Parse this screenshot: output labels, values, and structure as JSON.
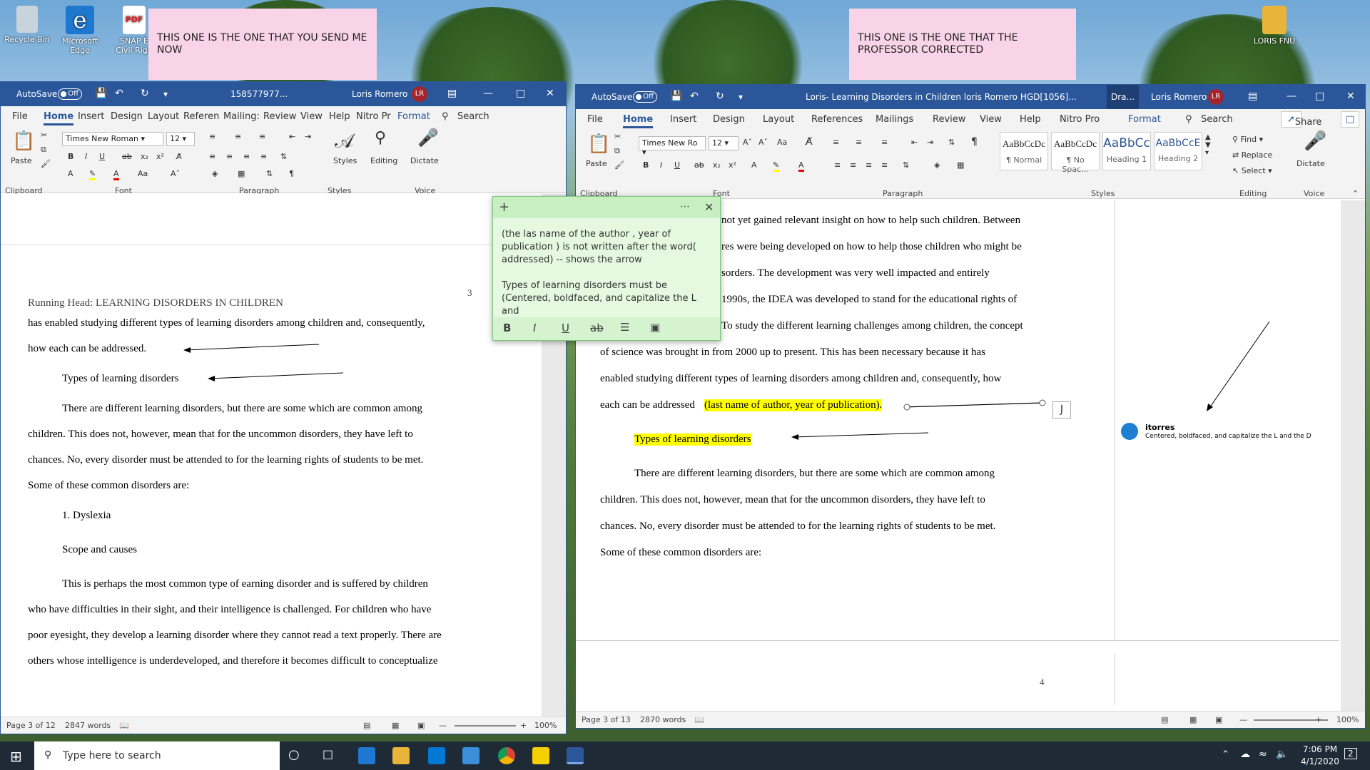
{
  "desktop": {
    "icons": [
      {
        "label": "Recycle Bin"
      },
      {
        "label": "Microsoft Edge"
      },
      {
        "label": "SNAP E Civil Righ"
      },
      {
        "label": "LORIS FNU"
      }
    ],
    "sticky_left": "THIS ONE IS THE ONE THAT YOU SEND ME NOW",
    "sticky_right": "THIS ONE IS THE ONE THAT THE PROFESSOR CORRECTED"
  },
  "left_window": {
    "autosave": "AutoSave",
    "toggle": "Off",
    "title": "158577977...",
    "user": "Loris Romero",
    "initials": "LR",
    "menu": [
      "File",
      "Home",
      "Insert",
      "Design",
      "Layout",
      "Referen",
      "Mailing:",
      "Review",
      "View",
      "Help",
      "Nitro Pr",
      "Format",
      "Search"
    ],
    "font_name": "Times New Roman",
    "font_size": "12",
    "groups": {
      "clipboard": "Clipboard",
      "font": "Font",
      "paragraph": "Paragraph",
      "styles": "Styles",
      "voice": "Voice"
    },
    "buttons": {
      "paste": "Paste",
      "styles": "Styles",
      "editing": "Editing",
      "dictate": "Dictate"
    },
    "running_head": "Running Head: LEARNING DISORDERS IN CHILDREN",
    "page_num": "3",
    "lines": [
      "has enabled studying different types of learning disorders among children and, consequently,",
      "how each can be addressed.",
      "Types of learning disorders",
      "There are different learning disorders, but there are some which are common among",
      "children. This does not, however, mean that for the uncommon disorders, they have left to",
      "chances. No, every disorder must be attended to for the learning rights of students to be met.",
      "Some of these common disorders are:",
      "1.   Dyslexia",
      "Scope and causes",
      "This is perhaps the most common type of earning disorder and is suffered by children",
      "who have difficulties in their sight, and their intelligence is challenged. For children who have",
      "poor eyesight, they develop a learning disorder where they cannot read a text properly. There are",
      "others whose intelligence is underdeveloped, and therefore it becomes difficult to conceptualize"
    ],
    "status": {
      "page": "Page 3 of 12",
      "words": "2847 words",
      "zoom": "100%"
    }
  },
  "right_window": {
    "autosave": "AutoSave",
    "toggle": "Off",
    "title": "Loris- Learning Disorders in Children loris Romero HGD[1056]...",
    "dra": "Dra...",
    "user": "Loris Romero",
    "initials": "LR",
    "menu": [
      "File",
      "Home",
      "Insert",
      "Design",
      "Layout",
      "References",
      "Mailings",
      "Review",
      "View",
      "Help",
      "Nitro Pro",
      "Format",
      "Search"
    ],
    "share": "Share",
    "font_name": "Times New Ro",
    "font_size": "12",
    "style_samples": [
      {
        "sample": "AaBbCcDc",
        "name": "¶ Normal"
      },
      {
        "sample": "AaBbCcDc",
        "name": "¶ No Spac..."
      },
      {
        "sample": "AaBbCс",
        "name": "Heading 1"
      },
      {
        "sample": "AaBbCcE",
        "name": "Heading 2"
      }
    ],
    "editing": [
      "Find",
      "Replace",
      "Select"
    ],
    "groups": {
      "clipboard": "Clipboard",
      "font": "Font",
      "paragraph": "Paragraph",
      "styles": "Styles",
      "editing": "Editing",
      "voice": "Voice"
    },
    "buttons": {
      "paste": "Paste",
      "dictate": "Dictate"
    },
    "lines": [
      "not yet gained relevant insight on how to help such children. Between",
      "res were being developed on how to help those children who might be",
      "sorders. The development was very well impacted and entirely",
      "1990s, the IDEA was developed to stand for the educational rights of",
      "To study the different learning challenges among children, the concept",
      "of science was brought in from 2000 up to present. This has been necessary because it has",
      "enabled studying different types of learning disorders among children and, consequently, how",
      "each can be addressed",
      "(last name of author, year of publication).",
      "Types of learning disorders",
      "There are different learning disorders, but there are some which are common among",
      "children. This does not, however, mean that for the uncommon disorders, they have left to",
      "chances. No, every disorder must be attended to for the learning rights of students to be met.",
      "Some of these common disorders are:"
    ],
    "comment": {
      "author": "itorres",
      "text": "Centered, boldfaced, and capitalize the L and the D"
    },
    "page_num": "4",
    "status": {
      "page": "Page 3 of 13",
      "words": "2870 words",
      "zoom": "100%"
    }
  },
  "sticky_note": {
    "p1": "(the las name of the author , year of publication ) is not written after the word( addressed)   -- shows the arrow",
    "p2": "Types of learning disorders must be (Centered, boldfaced, and capitalize the L and",
    "toolbar": [
      "B",
      "I",
      "U",
      "ab"
    ]
  },
  "taskbar": {
    "search": "Type here to search",
    "time": "7:06 PM",
    "date": "4/1/2020",
    "notif": "2"
  }
}
